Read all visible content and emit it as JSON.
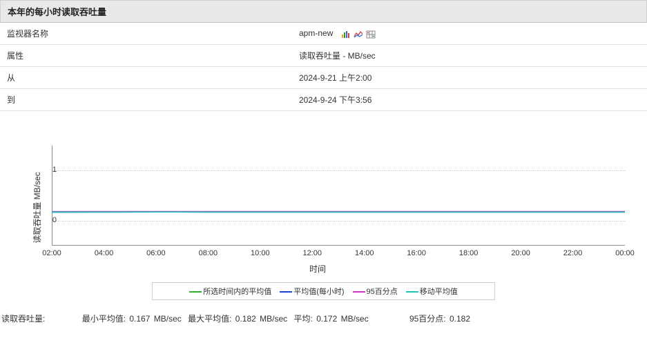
{
  "header": {
    "title": "本年的每小时读取吞吐量"
  },
  "info": {
    "rows": [
      {
        "label": "监视器名称",
        "value": "apm-new",
        "has_icons": true
      },
      {
        "label": "属性",
        "value": "读取吞吐量 - MB/sec"
      },
      {
        "label": "从",
        "value": "2024-9-21 上午2:00"
      },
      {
        "label": "到",
        "value": "2024-9-24 下午3:56"
      }
    ]
  },
  "chart_data": {
    "type": "line",
    "title": "",
    "xlabel": "时间",
    "ylabel": "读取吞吐量 MB/sec",
    "ylim": [
      -0.5,
      1.5
    ],
    "y_ticks": [
      0,
      1
    ],
    "x_categories": [
      "02:00",
      "04:00",
      "06:00",
      "08:00",
      "10:00",
      "12:00",
      "14:00",
      "16:00",
      "18:00",
      "20:00",
      "22:00",
      "00:00"
    ],
    "series": [
      {
        "name": "所选时间内的平均值",
        "color": "#2eae2e",
        "values": [
          0.17,
          0.172,
          0.173,
          0.172,
          0.172,
          0.172,
          0.172,
          0.172,
          0.172,
          0.172,
          0.172,
          0.172
        ]
      },
      {
        "name": "平均值(每小时)",
        "color": "#1a3fd8",
        "values": [
          0.17,
          0.172,
          0.173,
          0.172,
          0.172,
          0.172,
          0.172,
          0.172,
          0.172,
          0.172,
          0.172,
          0.172
        ]
      },
      {
        "name": "95百分点",
        "color": "#d030c8",
        "values": [
          0.18,
          0.182,
          0.182,
          0.182,
          0.182,
          0.182,
          0.182,
          0.182,
          0.182,
          0.182,
          0.182,
          0.182
        ]
      },
      {
        "name": "移动平均值",
        "color": "#1fc4b8",
        "values": [
          0.17,
          0.172,
          0.173,
          0.172,
          0.172,
          0.172,
          0.172,
          0.172,
          0.172,
          0.172,
          0.172,
          0.172
        ]
      }
    ]
  },
  "legend": {
    "items": [
      {
        "label": "所选时间内的平均值",
        "color": "#2eae2e"
      },
      {
        "label": "平均值(每小时)",
        "color": "#1a3fd8"
      },
      {
        "label": "95百分点",
        "color": "#d030c8"
      },
      {
        "label": "移动平均值",
        "color": "#1fc4b8"
      }
    ]
  },
  "stats": {
    "metric_label": "读取吞吐量:",
    "min_label": "最小平均值:",
    "min_value": "0.167",
    "min_unit": "MB/sec",
    "max_label": "最大平均值:",
    "max_value": "0.182",
    "max_unit": "MB/sec",
    "avg_label": "平均:",
    "avg_value": "0.172",
    "avg_unit": "MB/sec",
    "p95_label": "95百分点:",
    "p95_value": "0.182"
  }
}
